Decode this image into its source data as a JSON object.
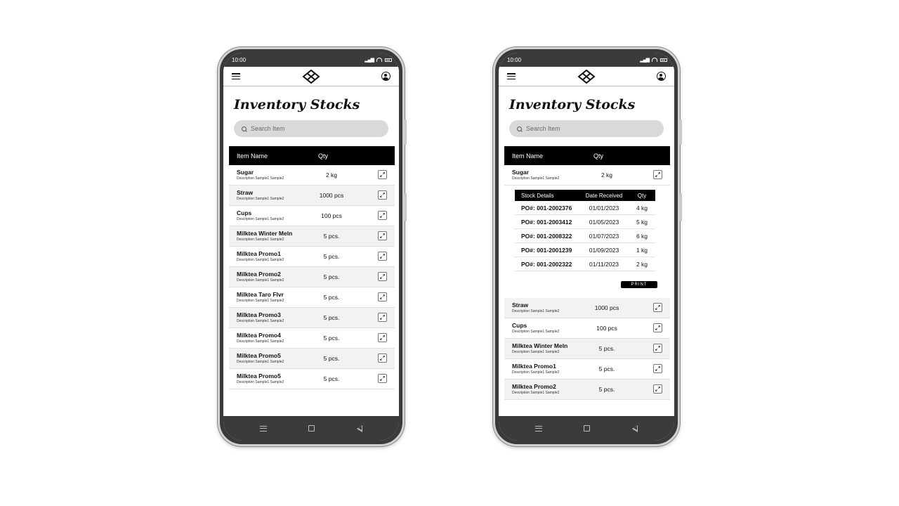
{
  "status": {
    "time": "10:00"
  },
  "page": {
    "title": "Inventory Stocks"
  },
  "search": {
    "placeholder": "Search Item"
  },
  "table": {
    "col_name": "Item Name",
    "col_qty": "Qty"
  },
  "left_items": [
    {
      "name": "Sugar",
      "desc": "Description Sample1 Sample2",
      "qty": "2 kg"
    },
    {
      "name": "Straw",
      "desc": "Description Sample1 Sample2",
      "qty": "1000 pcs"
    },
    {
      "name": "Cups",
      "desc": "Description Sample1 Sample2",
      "qty": "100 pcs"
    },
    {
      "name": "Milktea Winter Meln",
      "desc": "Description Sample1 Sample2",
      "qty": "5 pcs."
    },
    {
      "name": "Milktea Promo1",
      "desc": "Description Sample1 Sample2",
      "qty": "5 pcs."
    },
    {
      "name": "Milktea Promo2",
      "desc": "Description Sample1 Sample2",
      "qty": "5 pcs."
    },
    {
      "name": "Milktea Taro Flvr",
      "desc": "Description Sample1 Sample2",
      "qty": "5 pcs."
    },
    {
      "name": "Milktea Promo3",
      "desc": "Description Sample1 Sample2",
      "qty": "5 pcs."
    },
    {
      "name": "Milktea Promo4",
      "desc": "Description Sample1 Sample2",
      "qty": "5 pcs."
    },
    {
      "name": "Milktea Promo5",
      "desc": "Description Sample1 Sample2",
      "qty": "5 pcs."
    },
    {
      "name": "Milktea Promo5",
      "desc": "Description Sample1 Sample2",
      "qty": "5 pcs."
    }
  ],
  "right_top": {
    "name": "Sugar",
    "desc": "Description Sample1 Sample2",
    "qty": "2 kg"
  },
  "details": {
    "h_stock": "Stock Details",
    "h_date": "Date Received",
    "h_qty": "Qty",
    "rows": [
      {
        "po": "PO#: 001-2002376",
        "date": "01/01/2023",
        "qty": "4 kg"
      },
      {
        "po": "PO#: 001-2003412",
        "date": "01/05/2023",
        "qty": "5 kg"
      },
      {
        "po": "PO#: 001-2008322",
        "date": "01/07/2023",
        "qty": "6 kg"
      },
      {
        "po": "PO#: 001-2001239",
        "date": "01/09/2023",
        "qty": "1 kg"
      },
      {
        "po": "PO#: 001-2002322",
        "date": "01/11/2023",
        "qty": "2 kg"
      }
    ],
    "print_label": "PRINT"
  },
  "right_items": [
    {
      "name": "Straw",
      "desc": "Description Sample1 Sample2",
      "qty": "1000 pcs"
    },
    {
      "name": "Cups",
      "desc": "Description Sample1 Sample2",
      "qty": "100 pcs"
    },
    {
      "name": "Milktea Winter Meln",
      "desc": "Description Sample1 Sample2",
      "qty": "5 pcs."
    },
    {
      "name": "Milktea Promo1",
      "desc": "Description Sample1 Sample2",
      "qty": "5 pcs."
    },
    {
      "name": "Milktea Promo2",
      "desc": "Description Sample1 Sample2",
      "qty": "5 pcs."
    }
  ]
}
